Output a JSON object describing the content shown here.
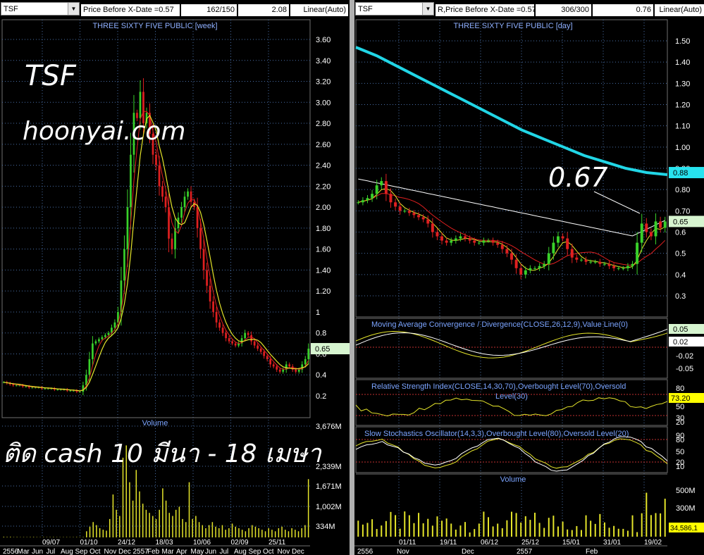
{
  "left": {
    "symbol": "TSF",
    "price_label": "Price Before X-Date =0.57",
    "bars_count": "162/150",
    "value_box": "2.08",
    "scale_label": "Linear(Auto)",
    "chart_title": "THREE SIXTY FIVE PUBLIC [week]",
    "annotation_ticker": "TSF",
    "annotation_site": "hoonyai.com",
    "annotation_note": "ติด cash 10 มีนา - 18 เมษา",
    "volume_label": "Volume"
  },
  "right": {
    "symbol": "TSF",
    "price_label": "R,Price Before X-Date =0.57",
    "bars_count": "306/300",
    "value_box": "0.76",
    "scale_label": "Linear(Auto)",
    "chart_title": "THREE SIXTY FIVE PUBLIC [day]",
    "annotation_price": "0.67",
    "macd_title": "Moving Average Convergence / Divergence(CLOSE,26,12,9),Value Line(0)",
    "rsi_title_line1": "Relative Strength Index(CLOSE,14,30,70),Overbought Level(70),Oversold",
    "rsi_title_line2": "Level(30)",
    "stoch_title": "Slow Stochastics Oscillator(14,3,3),Overbought Level(80),Oversold Level(20)",
    "volume_label": "Volume"
  },
  "colors": {
    "up": "#39d12a",
    "down": "#e02020",
    "ma_short": "#e5e52a",
    "ma_mid": "#e02020",
    "ma_long": "#ffffff",
    "ma_200": "#21d6e6",
    "grid": "#4a6fa8",
    "axis_label": "#7ba4ff",
    "last_price_box": "#d7f5d0",
    "ma200_box": "#27e3ef"
  },
  "chart_data": [
    {
      "id": "weekly-price",
      "type": "candlestick",
      "title": "THREE SIXTY FIVE PUBLIC [week]",
      "y_ticks": [
        "3.60",
        "3.40",
        "3.20",
        "3.00",
        "2.80",
        "2.60",
        "2.40",
        "2.20",
        "2.00",
        "1.80",
        "1.60",
        "1.40",
        "1.20",
        "1",
        "0.8",
        "0.6",
        "0.4",
        "0.2"
      ],
      "ylim": [
        0.2,
        3.6
      ],
      "last_price_label": "0.65",
      "x_ticks": [
        "09/07",
        "01/10",
        "24/12",
        "18/03",
        "10/06",
        "02/09",
        "25/11"
      ],
      "x_ticks_bottom": [
        "2556",
        "Mar",
        "Jun",
        "Jul",
        "Aug",
        "Sep",
        "Oct",
        "Nov",
        "Dec",
        "2557",
        "Feb",
        "Mar",
        "Apr",
        "May",
        "Jun",
        "Jul",
        "Aug",
        "Sep",
        "Oct",
        "Nov",
        "Dec"
      ],
      "close": [
        0.33,
        0.32,
        0.31,
        0.3,
        0.3,
        0.3,
        0.29,
        0.29,
        0.28,
        0.28,
        0.28,
        0.28,
        0.27,
        0.27,
        0.27,
        0.27,
        0.26,
        0.26,
        0.26,
        0.26,
        0.25,
        0.25,
        0.25,
        0.24,
        0.24,
        0.3,
        0.4,
        0.55,
        0.7,
        0.72,
        0.74,
        0.76,
        0.78,
        0.8,
        0.85,
        0.9,
        1.0,
        1.3,
        1.6,
        2.0,
        2.5,
        2.9,
        2.85,
        3.1,
        2.8,
        2.9,
        2.7,
        2.5,
        2.4,
        2.2,
        2.1,
        2.0,
        1.7,
        1.6,
        1.8,
        1.9,
        2.0,
        2.1,
        2.15,
        2.05,
        2.0,
        1.8,
        1.6,
        1.4,
        1.25,
        1.1,
        1.0,
        0.9,
        0.85,
        0.8,
        0.75,
        0.72,
        0.7,
        0.68,
        0.7,
        0.75,
        0.8,
        0.78,
        0.72,
        0.68,
        0.65,
        0.62,
        0.58,
        0.55,
        0.5,
        0.48,
        0.45,
        0.43,
        0.45,
        0.5,
        0.48,
        0.45,
        0.43,
        0.45,
        0.5,
        0.55,
        0.65
      ],
      "volume_y_ticks": [
        "3,676M",
        "2,339M",
        "1,671M",
        "1,002M",
        "334M"
      ],
      "volume_max": 3676,
      "volume": [
        20,
        15,
        18,
        10,
        12,
        8,
        10,
        9,
        12,
        14,
        10,
        8,
        11,
        9,
        10,
        12,
        8,
        7,
        9,
        10,
        8,
        9,
        12,
        10,
        11,
        200,
        350,
        500,
        400,
        300,
        250,
        220,
        600,
        1400,
        900,
        700,
        2600,
        3000,
        1800,
        1200,
        2200,
        1500,
        1100,
        900,
        800,
        700,
        600,
        900,
        1600,
        1200,
        800,
        700,
        900,
        1000,
        600,
        500,
        1800,
        600,
        700,
        500,
        400,
        300,
        400,
        500,
        350,
        300,
        400,
        250,
        300,
        450,
        350,
        300,
        250,
        200,
        300,
        400,
        350,
        300,
        250,
        200,
        300,
        250,
        200,
        300,
        350,
        250,
        200,
        300,
        250,
        200,
        300,
        400,
        1900
      ]
    },
    {
      "id": "daily-price",
      "type": "candlestick",
      "title": "THREE SIXTY FIVE PUBLIC [day]",
      "y_ticks": [
        "1.50",
        "1.40",
        "1.30",
        "1.20",
        "1.10",
        "1.00",
        "0.90",
        "0.80",
        "0.70",
        "0.6",
        "0.5",
        "0.4",
        "0.3"
      ],
      "ylim": [
        0.3,
        1.5
      ],
      "last_price_label": "0.65",
      "ma200_label": "0.88",
      "x_ticks": [
        "01/11",
        "19/11",
        "06/12",
        "25/12",
        "15/01",
        "31/01",
        "19/02"
      ],
      "x_ticks_bottom": [
        "2556",
        "Nov",
        "Dec",
        "2557",
        "Feb"
      ],
      "close": [
        0.74,
        0.75,
        0.76,
        0.78,
        0.82,
        0.84,
        0.78,
        0.74,
        0.72,
        0.7,
        0.7,
        0.69,
        0.68,
        0.67,
        0.66,
        0.64,
        0.6,
        0.58,
        0.56,
        0.55,
        0.56,
        0.57,
        0.58,
        0.57,
        0.56,
        0.55,
        0.55,
        0.56,
        0.56,
        0.55,
        0.54,
        0.52,
        0.5,
        0.47,
        0.43,
        0.4,
        0.42,
        0.43,
        0.43,
        0.44,
        0.45,
        0.5,
        0.55,
        0.58,
        0.57,
        0.52,
        0.48,
        0.47,
        0.47,
        0.46,
        0.46,
        0.46,
        0.45,
        0.45,
        0.44,
        0.43,
        0.43,
        0.43,
        0.44,
        0.45,
        0.55,
        0.64,
        0.6,
        0.58,
        0.65,
        0.62,
        0.65
      ],
      "ma200": [
        1.47,
        1.43,
        1.38,
        1.33,
        1.28,
        1.23,
        1.18,
        1.13,
        1.08,
        1.04,
        1.0,
        0.96,
        0.93,
        0.9,
        0.88,
        0.87
      ]
    },
    {
      "id": "macd",
      "type": "line",
      "title": "Moving Average Convergence / Divergence(CLOSE,26,12,9),Value Line(0)",
      "y_ticks": [
        "0.05",
        "0.02",
        "-0.02",
        "-0.05"
      ],
      "value_labels": [
        "0.05",
        "0.02"
      ]
    },
    {
      "id": "rsi",
      "type": "line",
      "title": "Relative Strength Index(CLOSE,14,30,70),Overbought Level(70),Oversold Level(30)",
      "y_ticks": [
        "80",
        "73.20",
        "50",
        "30",
        "20"
      ],
      "current_value": "73.20"
    },
    {
      "id": "stochastic",
      "type": "line",
      "title": "Slow Stochastics Oscillator(14,3,3),Overbought Level(80),Oversold Level(20)",
      "y_ticks": [
        "90",
        "80",
        "50",
        "20",
        "10"
      ]
    },
    {
      "id": "daily-volume",
      "type": "bar",
      "title": "Volume",
      "y_ticks": [
        "500M",
        "300M"
      ],
      "current_value": "34,586,1"
    }
  ]
}
